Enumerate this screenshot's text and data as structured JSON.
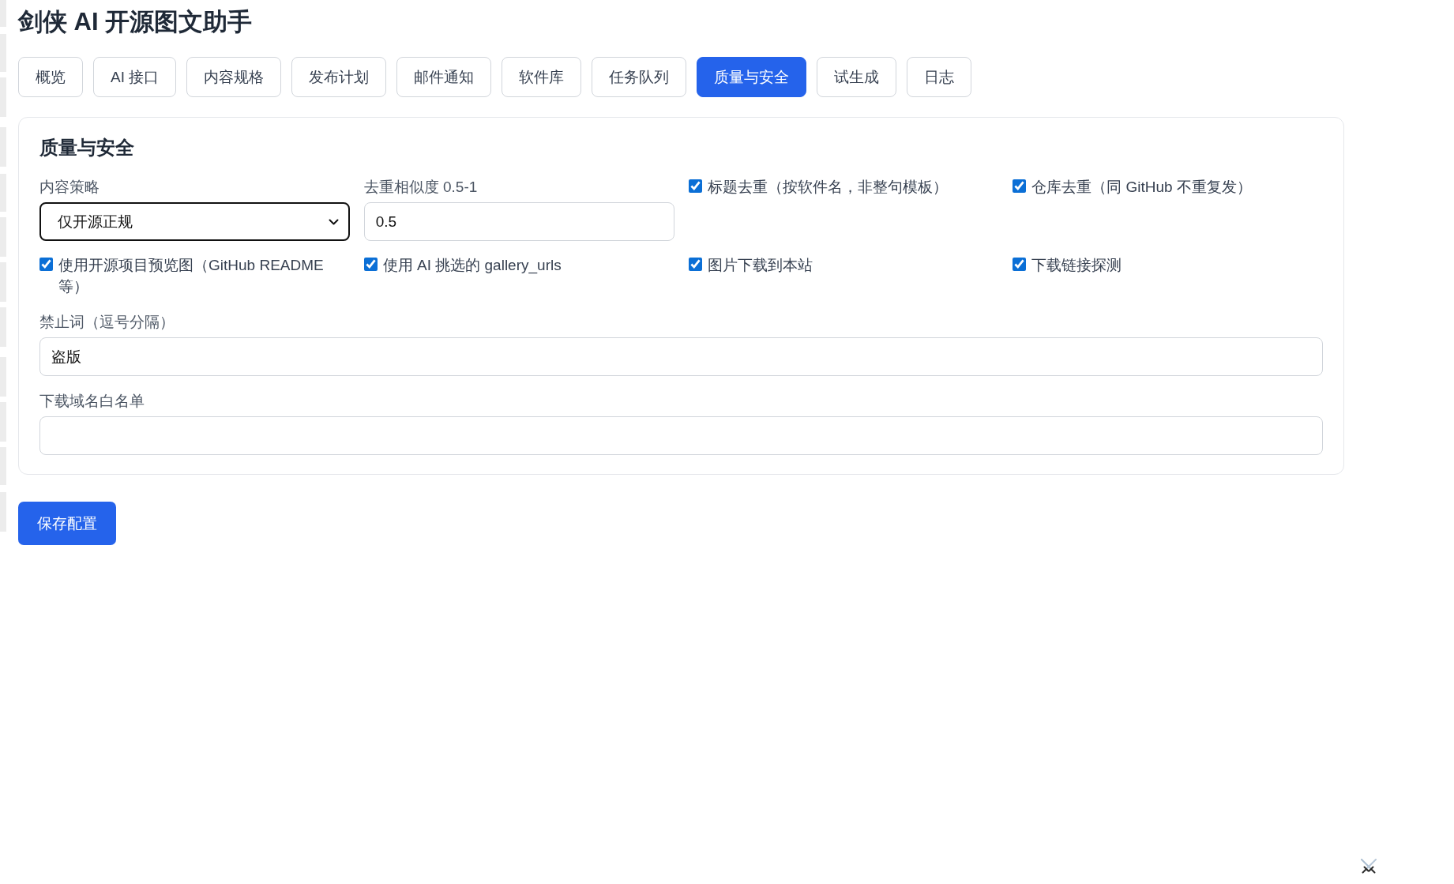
{
  "title": "剑侠 AI 开源图文助手",
  "tabs": [
    {
      "label": "概览",
      "selected": false
    },
    {
      "label": "AI 接口",
      "selected": false
    },
    {
      "label": "内容规格",
      "selected": false
    },
    {
      "label": "发布计划",
      "selected": false
    },
    {
      "label": "邮件通知",
      "selected": false
    },
    {
      "label": "软件库",
      "selected": false
    },
    {
      "label": "任务队列",
      "selected": false
    },
    {
      "label": "质量与安全",
      "selected": true
    },
    {
      "label": "试生成",
      "selected": false
    },
    {
      "label": "日志",
      "selected": false
    }
  ],
  "panel": {
    "heading": "质量与安全",
    "controls": [
      {
        "kind": "select",
        "label": "内容策略",
        "value": "仅开源正规",
        "focused": true
      },
      {
        "kind": "text",
        "label": "去重相似度 0.5-1",
        "value": "0.5",
        "focused": false
      },
      {
        "kind": "checkbox",
        "label": "标题去重（按软件名，非整句模板）",
        "checked": true
      },
      {
        "kind": "checkbox",
        "label": "仓库去重（同 GitHub 不重复发）",
        "checked": true
      },
      {
        "kind": "checkbox",
        "label": "使用开源项目预览图（GitHub README 等）",
        "checked": true
      },
      {
        "kind": "checkbox",
        "label": "使用 AI 挑选的 gallery_urls",
        "checked": true
      },
      {
        "kind": "checkbox",
        "label": "图片下载到本站",
        "checked": true
      },
      {
        "kind": "checkbox",
        "label": "下载链接探测",
        "checked": true
      }
    ],
    "fields": [
      {
        "label": "禁止词（逗号分隔）",
        "value": "盗版",
        "focused": false
      },
      {
        "label": "下载域名白名单",
        "focused": false
      }
    ]
  },
  "save_button": "保存配置"
}
